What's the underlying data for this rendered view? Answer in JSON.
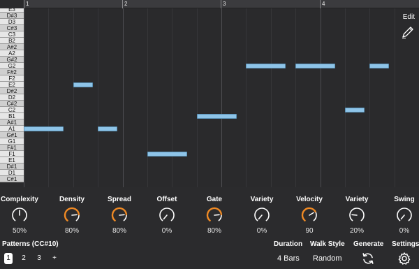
{
  "ruler": {
    "bars": [
      "1",
      "2",
      "3",
      "4"
    ]
  },
  "keys": [
    "E3",
    "D#3",
    "D3",
    "C#3",
    "C3",
    "B2",
    "A#2",
    "A2",
    "G#2",
    "G2",
    "F#2",
    "F2",
    "E2",
    "D#2",
    "D2",
    "C#2",
    "C2",
    "B1",
    "A#1",
    "A1",
    "G#1",
    "G1",
    "F#1",
    "F1",
    "E1",
    "D#1",
    "D1",
    "C#1"
  ],
  "notes": [
    {
      "pitch": "A1",
      "start": 0.0,
      "length": 0.4
    },
    {
      "pitch": "E2",
      "start": 0.5,
      "length": 0.2
    },
    {
      "pitch": "A1",
      "start": 0.75,
      "length": 0.2
    },
    {
      "pitch": "F1",
      "start": 1.25,
      "length": 0.4
    },
    {
      "pitch": "B1",
      "start": 1.75,
      "length": 0.4
    },
    {
      "pitch": "G2",
      "start": 2.25,
      "length": 0.4
    },
    {
      "pitch": "G2",
      "start": 2.75,
      "length": 0.4
    },
    {
      "pitch": "C2",
      "start": 3.25,
      "length": 0.2
    },
    {
      "pitch": "G2",
      "start": 3.5,
      "length": 0.2
    }
  ],
  "edit": {
    "label": "Edit",
    "icon": "pencil-icon"
  },
  "controls": [
    {
      "label": "Complexity",
      "value": "50%",
      "level": 0.5,
      "color": "#ffffff"
    },
    {
      "label": "Density",
      "value": "80%",
      "level": 0.8,
      "color": "#f08a24"
    },
    {
      "label": "Spread",
      "value": "80%",
      "level": 0.8,
      "color": "#f08a24"
    },
    {
      "label": "Offset",
      "value": "0%",
      "level": 0.0,
      "color": "#f08a24"
    },
    {
      "label": "Gate",
      "value": "80%",
      "level": 0.8,
      "color": "#f08a24"
    },
    {
      "label": "Variety",
      "value": "0%",
      "level": 0.0,
      "color": "#ffffff"
    },
    {
      "label": "Velocity",
      "value": "90",
      "level": 0.71,
      "color": "#f08a24"
    },
    {
      "label": "Variety",
      "value": "20%",
      "level": 0.2,
      "color": "#ffffff"
    },
    {
      "label": "Swing",
      "value": "0%",
      "level": 0.0,
      "color": "#ffffff"
    }
  ],
  "patterns": {
    "label": "Patterns (CC#10)",
    "tabs": [
      "1",
      "2",
      "3",
      "+"
    ],
    "active": 0
  },
  "duration": {
    "label": "Duration",
    "value": "4 Bars"
  },
  "walk_style": {
    "label": "Walk Style",
    "value": "Random"
  },
  "generate": {
    "label": "Generate",
    "icon": "refresh-icon"
  },
  "settings": {
    "label": "Settings",
    "icon": "gear-icon"
  },
  "colors": {
    "accent": "#f08a24",
    "note": "#8ec4e8",
    "background": "#2b2b2d"
  }
}
